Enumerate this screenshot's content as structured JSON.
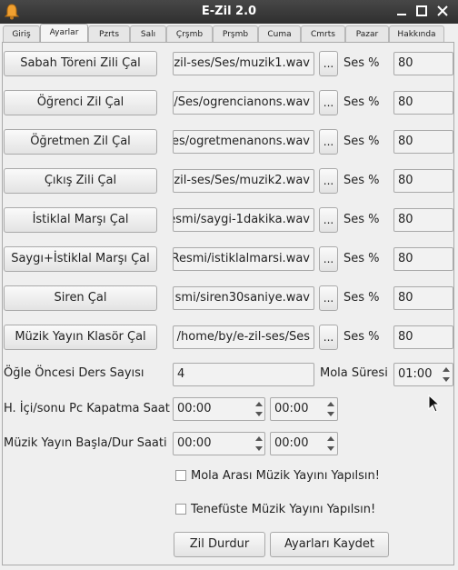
{
  "window": {
    "title": "E-Zil 2.0"
  },
  "tabs": [
    "Giriş",
    "Ayarlar",
    "Pzrts",
    "Salı",
    "Çrşmb",
    "Prşmb",
    "Cuma",
    "Cmrts",
    "Pazar",
    "Hakkında"
  ],
  "active_tab": "Ayarlar",
  "rows": [
    {
      "button": "Sabah Töreni Zili Çal",
      "path": "zil-ses/Ses/muzik1.wav",
      "browse": "...",
      "ses_label": "Ses %",
      "volume": "80"
    },
    {
      "button": "Öğrenci Zil Çal",
      "path": "/Ses/ogrencianons.wav",
      "browse": "...",
      "ses_label": "Ses %",
      "volume": "80"
    },
    {
      "button": "Öğretmen Zil Çal",
      "path": "es/ogretmenanons.wav",
      "browse": "...",
      "ses_label": "Ses %",
      "volume": "80"
    },
    {
      "button": "Çıkış Zili Çal",
      "path": "zil-ses/Ses/muzik2.wav",
      "browse": "...",
      "ses_label": "Ses %",
      "volume": "80"
    },
    {
      "button": "İstiklal Marşı Çal",
      "path": "esmi/saygi-1dakika.wav",
      "browse": "...",
      "ses_label": "Ses %",
      "volume": "80"
    },
    {
      "button": "Saygı+İstiklal Marşı Çal",
      "path": "Resmi/istiklalmarsi.wav",
      "browse": "...",
      "ses_label": "Ses %",
      "volume": "80"
    },
    {
      "button": "Siren Çal",
      "path": "smi/siren30saniye.wav",
      "browse": "...",
      "ses_label": "Ses %",
      "volume": "80"
    },
    {
      "button": "Müzik Yayın Klasör Çal",
      "path": "/home/by/e-zil-ses/Ses",
      "browse": "...",
      "ses_label": "Ses %",
      "volume": "80"
    }
  ],
  "ders": {
    "label": "Öğle Öncesi Ders Sayısı",
    "value": "4",
    "mola_label": "Mola Süresi",
    "mola_value": "01:00"
  },
  "pc_kapatma": {
    "label": "H. İçi/sonu Pc Kapatma Saat",
    "value1": "00:00",
    "value2": "00:00"
  },
  "muzik_yayin": {
    "label": "Müzik Yayın Başla/Dur Saati",
    "value1": "00:00",
    "value2": "00:00"
  },
  "checks": [
    {
      "label": "Mola Arası Müzik Yayını Yapılsın!",
      "checked": false
    },
    {
      "label": "Tenefüste Müzik Yayını Yapılsın!",
      "checked": false
    }
  ],
  "actions": {
    "stop": "Zil Durdur",
    "save": "Ayarları Kaydet"
  }
}
